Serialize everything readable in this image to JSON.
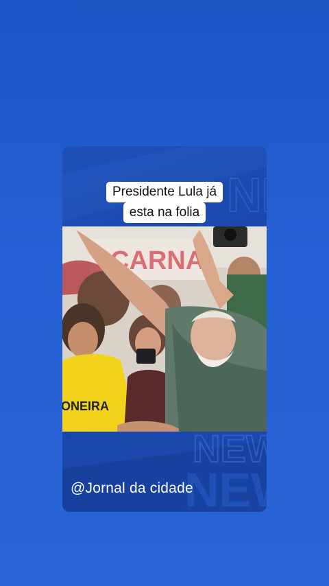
{
  "caption": {
    "line1": "Presidente Lula já",
    "line2": "esta na folia"
  },
  "watermark": "@Jornal da cidade",
  "photo": {
    "banner_text": "CARNA",
    "shirt_text": "ONEIRA"
  },
  "background_text": "NEWS",
  "colors": {
    "page_background": "#2560d4",
    "card_background": "#1a44a6",
    "caption_background": "#ffffff",
    "shirt_yellow": "#f2d21a"
  }
}
